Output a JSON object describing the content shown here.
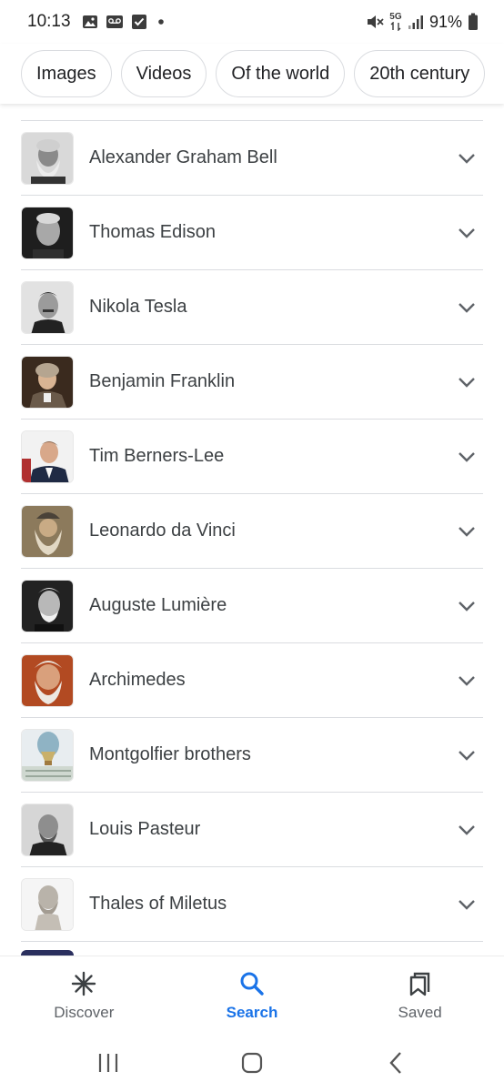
{
  "status_bar": {
    "time": "10:13",
    "network": "5G",
    "battery": "91%"
  },
  "chips": [
    {
      "label": "Images"
    },
    {
      "label": "Videos"
    },
    {
      "label": "Of the world"
    },
    {
      "label": "20th century"
    }
  ],
  "results": [
    {
      "name": "Alexander Graham Bell"
    },
    {
      "name": "Thomas Edison"
    },
    {
      "name": "Nikola Tesla"
    },
    {
      "name": "Benjamin Franklin"
    },
    {
      "name": "Tim Berners-Lee"
    },
    {
      "name": "Leonardo da Vinci"
    },
    {
      "name": "Auguste Lumière"
    },
    {
      "name": "Archimedes"
    },
    {
      "name": "Montgolfier brothers"
    },
    {
      "name": "Louis Pasteur"
    },
    {
      "name": "Thales of Miletus"
    }
  ],
  "bottom_nav": {
    "discover": "Discover",
    "search": "Search",
    "saved": "Saved"
  },
  "colors": {
    "accent": "#1a73e8",
    "divider": "#dadce0",
    "text": "#3c4043"
  }
}
